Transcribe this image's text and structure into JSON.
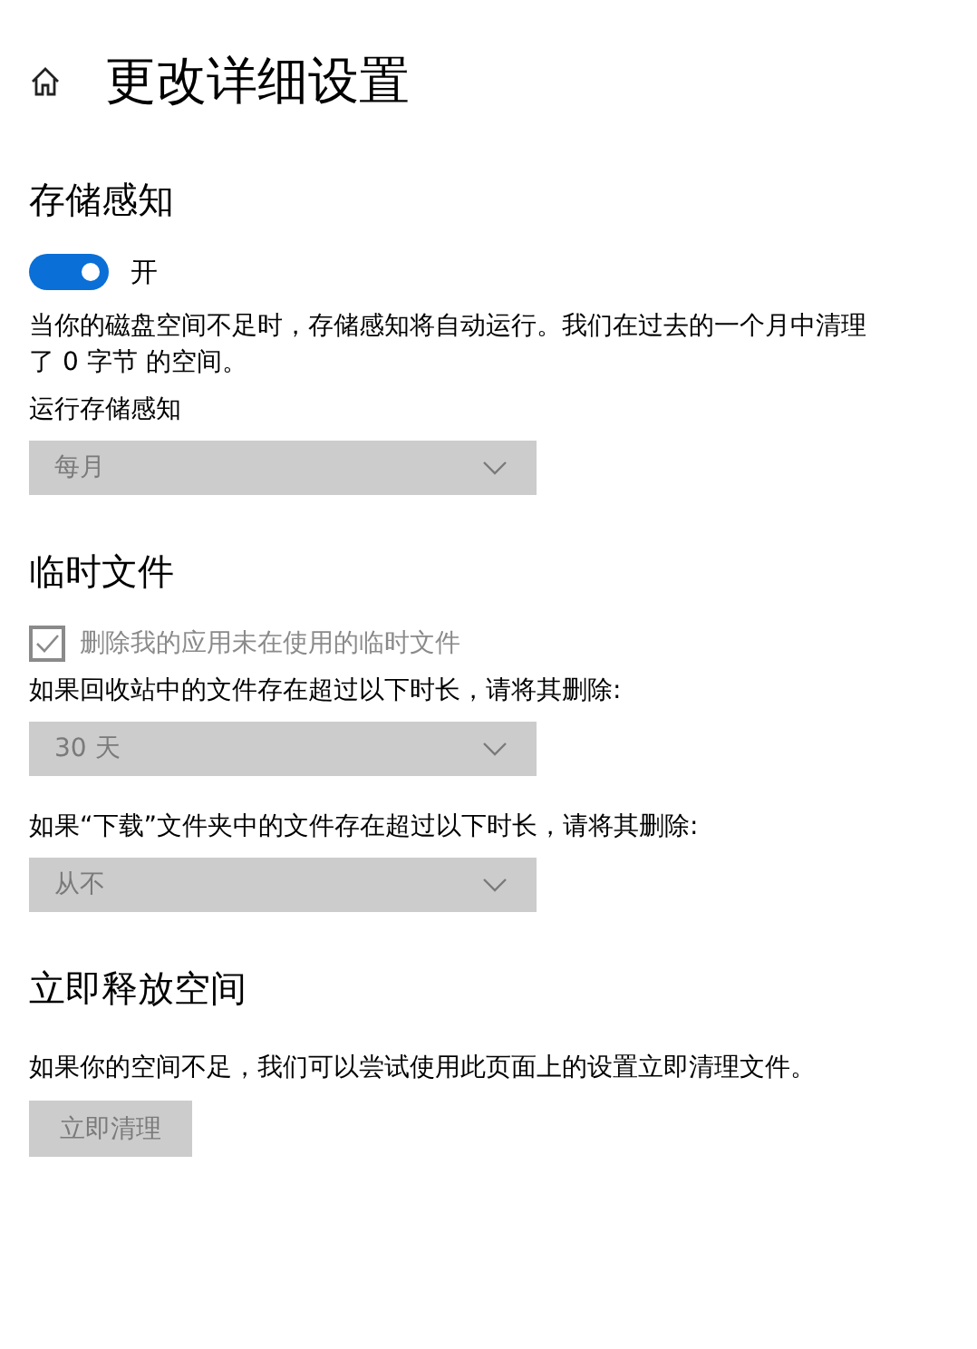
{
  "header": {
    "title": "更改详细设置"
  },
  "sections": [
    {
      "heading": "存储感知",
      "items": [
        {
          "kind": "toggle",
          "on": true,
          "label": "开"
        },
        {
          "kind": "text",
          "text": "当你的磁盘空间不足时，存储感知将自动运行。我们在过去的一个月中清理了 0 字节 的空间。"
        },
        {
          "kind": "label",
          "text": "运行存储感知"
        },
        {
          "kind": "dropdown",
          "value": "每月",
          "disabled": true
        }
      ]
    },
    {
      "heading": "临时文件",
      "items": [
        {
          "kind": "checkbox",
          "checked": true,
          "disabled": true,
          "label": "删除我的应用未在使用的临时文件"
        },
        {
          "kind": "label",
          "text": "如果回收站中的文件存在超过以下时长，请将其删除:"
        },
        {
          "kind": "dropdown",
          "value": "30 天",
          "disabled": true
        },
        {
          "kind": "label",
          "text": "如果“下载”文件夹中的文件存在超过以下时长，请将其删除:"
        },
        {
          "kind": "dropdown",
          "value": "从不",
          "disabled": true
        }
      ]
    },
    {
      "heading": "立即释放空间",
      "items": [
        {
          "kind": "text",
          "text": "如果你的空间不足，我们可以尝试使用此页面上的设置立即清理文件。"
        },
        {
          "kind": "button",
          "label": "立即清理",
          "disabled": true
        }
      ]
    }
  ]
}
